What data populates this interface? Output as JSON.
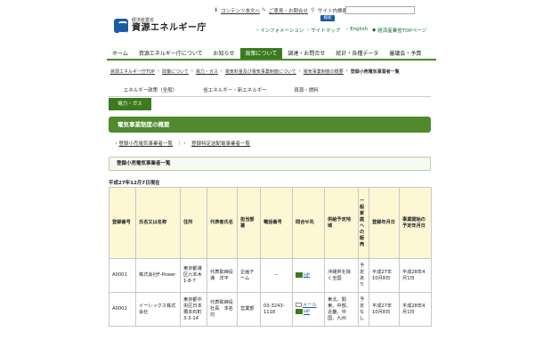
{
  "header": {
    "logo_sub": "経済産業省",
    "logo_main": "資源エネルギー庁",
    "utility": {
      "contents": "コンテンツ本文へ",
      "opinion": "ご意見・お問合せ",
      "site_search": "サイト内検索",
      "search_button": "検索",
      "search_value": ""
    },
    "subnav": [
      "インフォメーション",
      "サイトマップ",
      "English",
      "経済産業省TOPページ"
    ]
  },
  "nav": {
    "items": [
      "ホーム",
      "資源エネルギー庁について",
      "お知らせ",
      "政策について",
      "調達・お問合せ",
      "統計・各種データ",
      "審議会・予算"
    ],
    "active": "政策について"
  },
  "breadcrumb": [
    "資源エネルギー庁TOP",
    "政策について",
    "電力・ガス",
    "電気料金及び電気事業制度について",
    "電気事業制度の概要",
    "登録小売電気事業者一覧"
  ],
  "category_tabs": [
    "エネルギー政策（全般）",
    "省エネルギー・新エネルギー",
    "資源・燃料",
    "電力・ガス"
  ],
  "section_title": "電気事業制度の概要",
  "sublinks": [
    "登録小売電気事業者一覧",
    "登録特定送配電事業者一覧"
  ],
  "registry_title": "登録小売電気事業者一覧",
  "as_of": "平成27年12月7日現在",
  "table": {
    "headers": [
      "登録番号",
      "氏名又は名称",
      "住所",
      "代表者氏名",
      "担当部署",
      "電話番号",
      "問合せ先",
      "供給予定地域",
      "一般家庭への販売",
      "登録年月日",
      "事業開始の予定年月日"
    ],
    "rows": [
      {
        "no": "A0001",
        "name": "株式会社F-Power",
        "address": "東京都港区六本木1-8-7",
        "rep": "代表取締役　満　洋平",
        "dept": "企画チーム",
        "tel": "－",
        "contact_mail": "",
        "contact_hp": "HP",
        "area": "沖縄県を除く全国",
        "household": "予定あり",
        "reg_date": "平成27年10月8日",
        "start_date": "平成28年4月1日"
      },
      {
        "no": "A0002",
        "name": "イーレックス株式会社",
        "address": "東京都中央区日本橋本石町3-3-14",
        "rep": "代表取締役社長　本名　均",
        "dept": "営業部",
        "tel": "03-3243-1118",
        "contact_mail": "メール",
        "contact_hp": "HP",
        "area": "東北、関東、中部、近畿、中国、九州",
        "household": "予定なし",
        "reg_date": "平成27年10月8日",
        "start_date": "平成28年4月1日"
      }
    ]
  },
  "colors": {
    "green": "#3b7a1e",
    "section_green": "#4f8a2d",
    "header_bg": "#fdf7d4",
    "blue": "#1a5aa6"
  }
}
